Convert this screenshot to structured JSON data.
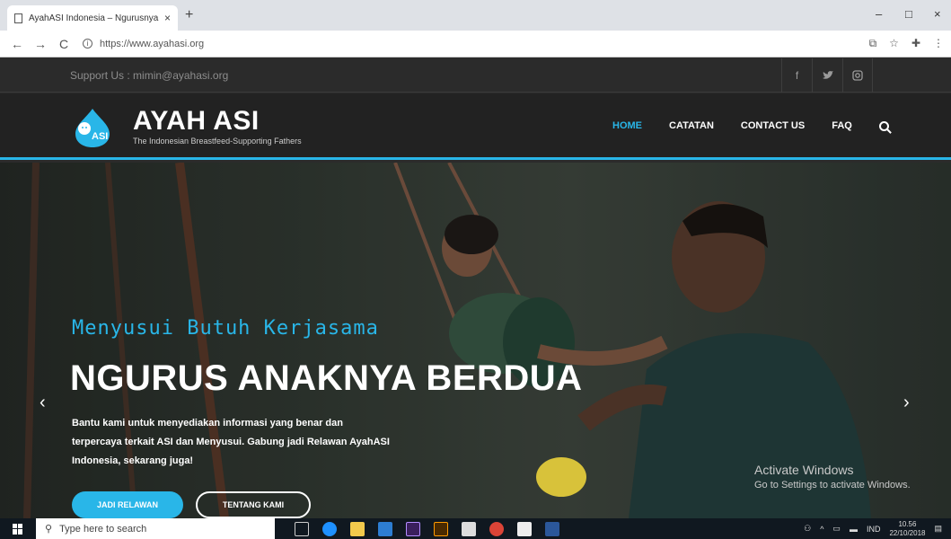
{
  "browser": {
    "tab_title": "AyahASI Indonesia – Ngurusnya",
    "tab_close": "×",
    "new_tab": "+",
    "url": "https://www.ayahasi.org",
    "minimize": "–",
    "maximize": "□",
    "close": "×"
  },
  "topbar": {
    "support_text": "Support Us : mimin@ayahasi.org",
    "social": [
      {
        "icon": "facebook-icon",
        "glyph": "f"
      },
      {
        "icon": "twitter-icon",
        "glyph": "🐦"
      },
      {
        "icon": "instagram-icon",
        "glyph": "◙"
      }
    ]
  },
  "header": {
    "brand_name": "AYAH ASI",
    "logo_text": "ASI",
    "tagline": "The Indonesian Breastfeed-Supporting Fathers",
    "menu": [
      "HOME",
      "CATATAN",
      "CONTACT US",
      "FAQ"
    ],
    "active_menu": "HOME"
  },
  "hero": {
    "subtitle": "Menyusui Butuh Kerjasama",
    "headline": "NGURUS ANAKNYA BERDUA",
    "description": "Bantu kami untuk menyediakan informasi yang benar dan terpercaya terkait ASI dan Menyusui. Gabung jadi Relawan AyahASI Indonesia, sekarang juga!",
    "primary_button": "JADI RELAWAN",
    "secondary_button": "TENTANG KAMI",
    "prev": "‹",
    "next": "›"
  },
  "watermark": {
    "line1": "Activate Windows",
    "line2": "Go to Settings to activate Windows."
  },
  "taskbar": {
    "search_placeholder": "Type here to search",
    "language": "IND",
    "time": "10.56",
    "date": "22/10/2018"
  },
  "colors": {
    "accent": "#29b6e8",
    "header_bg": "#222222",
    "topbar_bg": "#2b2b2b"
  }
}
